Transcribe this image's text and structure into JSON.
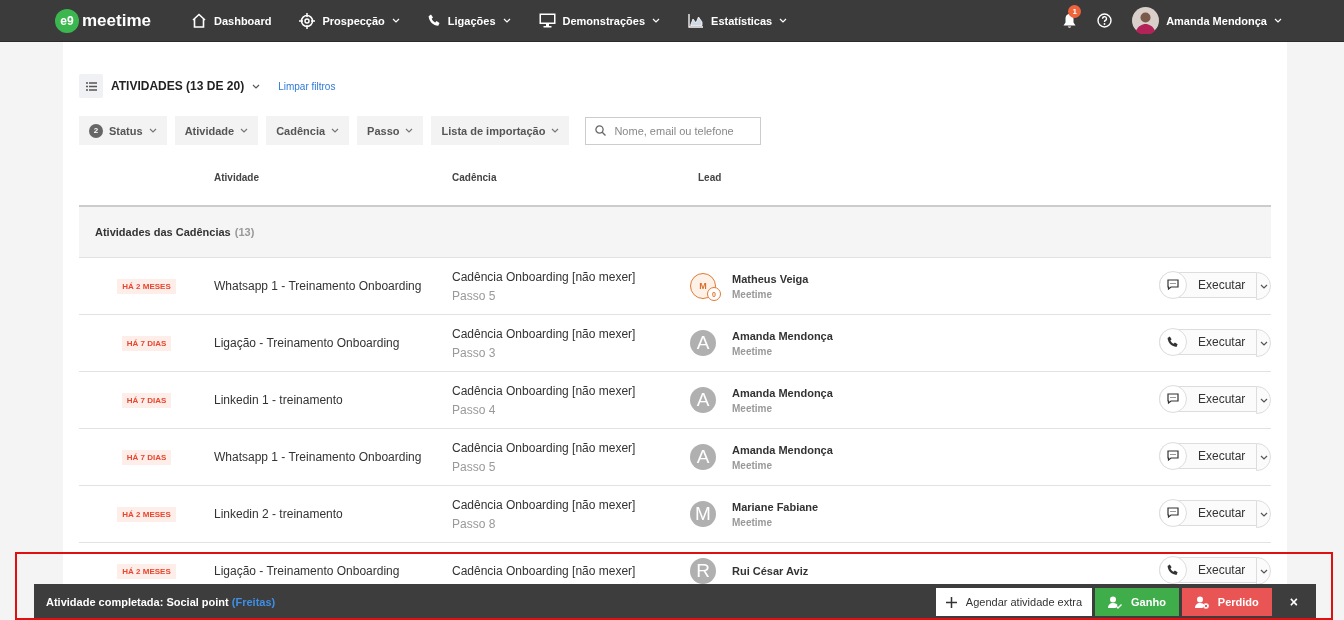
{
  "nav": {
    "logo_mark": "e9",
    "logo_text": "meetime",
    "items": [
      {
        "label": "Dashboard",
        "has_menu": false
      },
      {
        "label": "Prospecção",
        "has_menu": true
      },
      {
        "label": "Ligações",
        "has_menu": true
      },
      {
        "label": "Demonstrações",
        "has_menu": true
      },
      {
        "label": "Estatísticas",
        "has_menu": true
      }
    ],
    "notification_count": "1",
    "user_name": "Amanda Mendonça"
  },
  "toolbar": {
    "title": "ATIVIDADES (13 DE 20)",
    "clear_link": "Limpar filtros",
    "filters": [
      {
        "label": "Status",
        "count": "2"
      },
      {
        "label": "Atividade"
      },
      {
        "label": "Cadência"
      },
      {
        "label": "Passo"
      },
      {
        "label": "Lista de importação"
      }
    ],
    "search": {
      "placeholder": "Nome, email ou telefone"
    }
  },
  "table": {
    "columns": [
      "Atividade",
      "Cadência",
      "Lead"
    ],
    "group": {
      "title": "Atividades das Cadências",
      "count": "(13)"
    },
    "rows": [
      {
        "due": "HÁ 2 MESES",
        "activity": "Whatsapp 1 - Treinamento Onboarding",
        "cadence": "Cadência Onboarding [não mexer]",
        "step": "Passo 5",
        "lead": "Matheus Veiga",
        "company": "Meetime",
        "avatar": {
          "kind": "outlined",
          "initial": "M",
          "score": "0"
        },
        "action": {
          "kind": "message",
          "label": "Executar"
        }
      },
      {
        "due": "HÁ 7 DIAS",
        "activity": "Ligação - Treinamento Onboarding",
        "cadence": "Cadência Onboarding [não mexer]",
        "step": "Passo 3",
        "lead": "Amanda Mendonça",
        "company": "Meetime",
        "avatar": {
          "kind": "filled",
          "initial": "A"
        },
        "action": {
          "kind": "call",
          "label": "Executar"
        }
      },
      {
        "due": "HÁ 7 DIAS",
        "activity": "Linkedin 1 - treinamento",
        "cadence": "Cadência Onboarding [não mexer]",
        "step": "Passo 4",
        "lead": "Amanda Mendonça",
        "company": "Meetime",
        "avatar": {
          "kind": "filled",
          "initial": "A"
        },
        "action": {
          "kind": "message",
          "label": "Executar"
        }
      },
      {
        "due": "HÁ 7 DIAS",
        "activity": "Whatsapp 1 - Treinamento Onboarding",
        "cadence": "Cadência Onboarding [não mexer]",
        "step": "Passo 5",
        "lead": "Amanda Mendonça",
        "company": "Meetime",
        "avatar": {
          "kind": "filled",
          "initial": "A"
        },
        "action": {
          "kind": "message",
          "label": "Executar"
        }
      },
      {
        "due": "HÁ 2 MESES",
        "activity": "Linkedin 2 - treinamento",
        "cadence": "Cadência Onboarding [não mexer]",
        "step": "Passo 8",
        "lead": "Mariane Fabiane",
        "company": "Meetime",
        "avatar": {
          "kind": "filled",
          "initial": "M"
        },
        "action": {
          "kind": "message",
          "label": "Executar"
        }
      },
      {
        "due": "HÁ 2 MESES",
        "activity": "Ligação - Treinamento Onboarding",
        "cadence": "Cadência Onboarding [não mexer]",
        "lead": "Rui César Aviz",
        "avatar": {
          "kind": "filled",
          "initial": "R"
        },
        "action": {
          "kind": "call",
          "label": "Executar"
        }
      }
    ]
  },
  "toast": {
    "message": "Atividade completada: Social point",
    "link": "(Freitas)",
    "buttons": [
      {
        "label": "Agendar atividade extra",
        "kind": "schedule"
      },
      {
        "label": "Ganho",
        "kind": "won"
      },
      {
        "label": "Perdido",
        "kind": "lost"
      }
    ],
    "close": "×"
  }
}
